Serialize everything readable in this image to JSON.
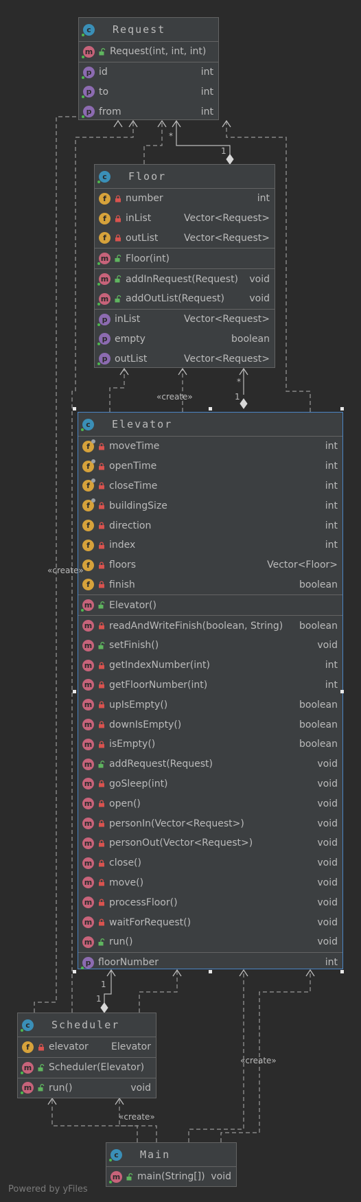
{
  "classes": {
    "request": {
      "name": "Request",
      "constructors": [
        {
          "label": "Request(int, int, int)",
          "type": ""
        }
      ],
      "properties": [
        {
          "label": "id",
          "type": "int"
        },
        {
          "label": "to",
          "type": "int"
        },
        {
          "label": "from",
          "type": "int"
        }
      ]
    },
    "floor": {
      "name": "Floor",
      "fields": [
        {
          "label": "number",
          "type": "int"
        },
        {
          "label": "inList",
          "type": "Vector<Request>"
        },
        {
          "label": "outList",
          "type": "Vector<Request>"
        }
      ],
      "constructors": [
        {
          "label": "Floor(int)",
          "type": ""
        }
      ],
      "methods": [
        {
          "label": "addInRequest(Request)",
          "type": "void"
        },
        {
          "label": "addOutList(Request)",
          "type": "void"
        }
      ],
      "properties": [
        {
          "label": "inList",
          "type": "Vector<Request>"
        },
        {
          "label": "empty",
          "type": "boolean"
        },
        {
          "label": "outList",
          "type": "Vector<Request>"
        }
      ]
    },
    "elevator": {
      "name": "Elevator",
      "fields": [
        {
          "label": "moveTime",
          "type": "int"
        },
        {
          "label": "openTime",
          "type": "int"
        },
        {
          "label": "closeTime",
          "type": "int"
        },
        {
          "label": "buildingSize",
          "type": "int"
        },
        {
          "label": "direction",
          "type": "int"
        },
        {
          "label": "index",
          "type": "int"
        },
        {
          "label": "floors",
          "type": "Vector<Floor>"
        },
        {
          "label": "finish",
          "type": "boolean"
        }
      ],
      "constructors": [
        {
          "label": "Elevator()",
          "type": ""
        }
      ],
      "methods": [
        {
          "label": "readAndWriteFinish(boolean, String)",
          "type": "boolean"
        },
        {
          "label": "setFinish()",
          "type": "void"
        },
        {
          "label": "getIndexNumber(int)",
          "type": "int"
        },
        {
          "label": "getFloorNumber(int)",
          "type": "int"
        },
        {
          "label": "upIsEmpty()",
          "type": "boolean"
        },
        {
          "label": "downIsEmpty()",
          "type": "boolean"
        },
        {
          "label": "isEmpty()",
          "type": "boolean"
        },
        {
          "label": "addRequest(Request)",
          "type": "void"
        },
        {
          "label": "goSleep(int)",
          "type": "void"
        },
        {
          "label": "open()",
          "type": "void"
        },
        {
          "label": "personIn(Vector<Request>)",
          "type": "void"
        },
        {
          "label": "personOut(Vector<Request>)",
          "type": "void"
        },
        {
          "label": "close()",
          "type": "void"
        },
        {
          "label": "move()",
          "type": "void"
        },
        {
          "label": "processFloor()",
          "type": "void"
        },
        {
          "label": "waitForRequest()",
          "type": "void"
        },
        {
          "label": "run()",
          "type": "void"
        }
      ],
      "properties": [
        {
          "label": "floorNumber",
          "type": "int"
        }
      ]
    },
    "scheduler": {
      "name": "Scheduler",
      "fields": [
        {
          "label": "elevator",
          "type": "Elevator"
        }
      ],
      "constructors": [
        {
          "label": "Scheduler(Elevator)",
          "type": ""
        }
      ],
      "methods": [
        {
          "label": "run()",
          "type": "void"
        }
      ]
    },
    "main": {
      "name": "Main",
      "methods": [
        {
          "label": "main(String[])",
          "type": "void"
        }
      ]
    }
  },
  "edge_labels": {
    "create_floor": "«create»",
    "create_left": "«create»",
    "create_right": "«create»",
    "create_bottom": "«create»"
  },
  "multiplicities": {
    "req_floor_star": "*",
    "req_floor_one": "1",
    "floor_elev_star": "*",
    "floor_elev_one": "1",
    "elev_sched_one_a": "1",
    "elev_sched_one_b": "1"
  },
  "watermark": "Powered by yFiles",
  "colors": {
    "background": "#2b2b2b",
    "class_fill": "#3c3f41",
    "selected_border": "#4b86c6",
    "class_icon": "#3a8fb7",
    "method_icon": "#c7637a",
    "property_icon": "#8c6bb1",
    "field_icon": "#d6a23b"
  }
}
